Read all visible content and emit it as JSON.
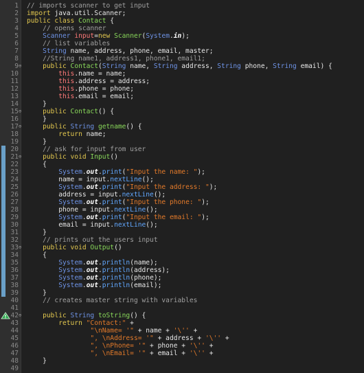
{
  "theme": {
    "background": "#202020",
    "keyword": "#e3c84f",
    "string": "#e37a2a",
    "comment": "#a0a0a0",
    "field": "#ff7a79",
    "type": "#6e93e6",
    "function": "#89d85a",
    "line_number": "#8a8a8a",
    "overview_marker": "#6aa0c8"
  },
  "editor": {
    "lines": [
      {
        "n": "1",
        "fold": "",
        "tokens": [
          {
            "t": "// imports scanner to get input",
            "c": "com"
          }
        ]
      },
      {
        "n": "2",
        "fold": "",
        "tokens": [
          {
            "t": "import ",
            "c": "kw"
          },
          {
            "t": "java.util.Scanner;",
            "c": "id"
          }
        ]
      },
      {
        "n": "3",
        "fold": "",
        "tokens": [
          {
            "t": "public class ",
            "c": "kw"
          },
          {
            "t": "Contact",
            "c": "fn"
          },
          {
            "t": " {",
            "c": "id"
          }
        ]
      },
      {
        "n": "4",
        "fold": "",
        "tokens": [
          {
            "t": "    // opens scanner",
            "c": "com"
          }
        ]
      },
      {
        "n": "5",
        "fold": "",
        "tokens": [
          {
            "t": "    ",
            "c": "id"
          },
          {
            "t": "Scanner",
            "c": "type"
          },
          {
            "t": " ",
            "c": "id"
          },
          {
            "t": "input",
            "c": "field"
          },
          {
            "t": "=",
            "c": "id"
          },
          {
            "t": "new ",
            "c": "kw"
          },
          {
            "t": "Scanner",
            "c": "fn"
          },
          {
            "t": "(",
            "c": "id"
          },
          {
            "t": "System",
            "c": "type"
          },
          {
            "t": ".",
            "c": "id"
          },
          {
            "t": "in",
            "c": "em"
          },
          {
            "t": ");",
            "c": "id"
          }
        ]
      },
      {
        "n": "6",
        "fold": "",
        "tokens": [
          {
            "t": "    // list variables",
            "c": "com"
          }
        ]
      },
      {
        "n": "7",
        "fold": "",
        "tokens": [
          {
            "t": "    ",
            "c": "id"
          },
          {
            "t": "String",
            "c": "type"
          },
          {
            "t": " name, address, phone, email, master;",
            "c": "id"
          }
        ]
      },
      {
        "n": "8",
        "fold": "",
        "tokens": [
          {
            "t": "    //String name1, address1, phone1, email1;",
            "c": "com"
          }
        ]
      },
      {
        "n": "9",
        "fold": "⊖",
        "tokens": [
          {
            "t": "    public ",
            "c": "kw"
          },
          {
            "t": "Contact",
            "c": "fn"
          },
          {
            "t": "(",
            "c": "id"
          },
          {
            "t": "String",
            "c": "type"
          },
          {
            "t": " name, ",
            "c": "id"
          },
          {
            "t": "String",
            "c": "type"
          },
          {
            "t": " address, ",
            "c": "id"
          },
          {
            "t": "String",
            "c": "type"
          },
          {
            "t": " phone, ",
            "c": "id"
          },
          {
            "t": "String",
            "c": "type"
          },
          {
            "t": " email) {",
            "c": "id"
          }
        ]
      },
      {
        "n": "10",
        "fold": "",
        "tokens": [
          {
            "t": "        ",
            "c": "id"
          },
          {
            "t": "this",
            "c": "field"
          },
          {
            "t": ".name = name;",
            "c": "id"
          }
        ]
      },
      {
        "n": "11",
        "fold": "",
        "tokens": [
          {
            "t": "        ",
            "c": "id"
          },
          {
            "t": "this",
            "c": "field"
          },
          {
            "t": ".address = address;",
            "c": "id"
          }
        ]
      },
      {
        "n": "12",
        "fold": "",
        "tokens": [
          {
            "t": "        ",
            "c": "id"
          },
          {
            "t": "this",
            "c": "field"
          },
          {
            "t": ".phone = phone;",
            "c": "id"
          }
        ]
      },
      {
        "n": "13",
        "fold": "",
        "tokens": [
          {
            "t": "        ",
            "c": "id"
          },
          {
            "t": "this",
            "c": "field"
          },
          {
            "t": ".email = email;",
            "c": "id"
          }
        ]
      },
      {
        "n": "14",
        "fold": "",
        "tokens": [
          {
            "t": "    }",
            "c": "id"
          }
        ]
      },
      {
        "n": "15",
        "fold": "⊖",
        "tokens": [
          {
            "t": "    public ",
            "c": "kw"
          },
          {
            "t": "Contact",
            "c": "fn"
          },
          {
            "t": "() {",
            "c": "id"
          }
        ]
      },
      {
        "n": "16",
        "fold": "",
        "tokens": [
          {
            "t": "    }",
            "c": "id"
          }
        ]
      },
      {
        "n": "17",
        "fold": "⊖",
        "tokens": [
          {
            "t": "    public ",
            "c": "kw"
          },
          {
            "t": "String",
            "c": "type"
          },
          {
            "t": " ",
            "c": "id"
          },
          {
            "t": "getname",
            "c": "fn"
          },
          {
            "t": "() {",
            "c": "id"
          }
        ]
      },
      {
        "n": "18",
        "fold": "",
        "tokens": [
          {
            "t": "        return ",
            "c": "kw"
          },
          {
            "t": "name;",
            "c": "id"
          }
        ]
      },
      {
        "n": "19",
        "fold": "",
        "tokens": [
          {
            "t": "    }",
            "c": "id"
          }
        ]
      },
      {
        "n": "20",
        "fold": "",
        "tokens": [
          {
            "t": "    // ask for input from user",
            "c": "com"
          }
        ]
      },
      {
        "n": "21",
        "fold": "⊖",
        "tokens": [
          {
            "t": "    public void ",
            "c": "kw"
          },
          {
            "t": "Input",
            "c": "fn"
          },
          {
            "t": "()",
            "c": "id"
          }
        ]
      },
      {
        "n": "22",
        "fold": "",
        "tokens": [
          {
            "t": "    {",
            "c": "id"
          }
        ]
      },
      {
        "n": "23",
        "fold": "",
        "tokens": [
          {
            "t": "        ",
            "c": "id"
          },
          {
            "t": "System",
            "c": "type"
          },
          {
            "t": ".",
            "c": "id"
          },
          {
            "t": "out",
            "c": "em"
          },
          {
            "t": ".",
            "c": "id"
          },
          {
            "t": "print",
            "c": "call"
          },
          {
            "t": "(",
            "c": "id"
          },
          {
            "t": "\"Input the name: \"",
            "c": "str"
          },
          {
            "t": ");",
            "c": "id"
          }
        ]
      },
      {
        "n": "24",
        "fold": "",
        "tokens": [
          {
            "t": "        name = input.",
            "c": "id"
          },
          {
            "t": "nextLine",
            "c": "call"
          },
          {
            "t": "();",
            "c": "id"
          }
        ]
      },
      {
        "n": "25",
        "fold": "",
        "tokens": [
          {
            "t": "        ",
            "c": "id"
          },
          {
            "t": "System",
            "c": "type"
          },
          {
            "t": ".",
            "c": "id"
          },
          {
            "t": "out",
            "c": "em"
          },
          {
            "t": ".",
            "c": "id"
          },
          {
            "t": "print",
            "c": "call"
          },
          {
            "t": "(",
            "c": "id"
          },
          {
            "t": "\"Input the address: \"",
            "c": "str"
          },
          {
            "t": ");",
            "c": "id"
          }
        ]
      },
      {
        "n": "26",
        "fold": "",
        "tokens": [
          {
            "t": "        address = input.",
            "c": "id"
          },
          {
            "t": "nextLine",
            "c": "call"
          },
          {
            "t": "();",
            "c": "id"
          }
        ]
      },
      {
        "n": "27",
        "fold": "",
        "tokens": [
          {
            "t": "        ",
            "c": "id"
          },
          {
            "t": "System",
            "c": "type"
          },
          {
            "t": ".",
            "c": "id"
          },
          {
            "t": "out",
            "c": "em"
          },
          {
            "t": ".",
            "c": "id"
          },
          {
            "t": "print",
            "c": "call"
          },
          {
            "t": "(",
            "c": "id"
          },
          {
            "t": "\"Input the phone: \"",
            "c": "str"
          },
          {
            "t": ");",
            "c": "id"
          }
        ]
      },
      {
        "n": "28",
        "fold": "",
        "tokens": [
          {
            "t": "        phone = input.",
            "c": "id"
          },
          {
            "t": "nextLine",
            "c": "call"
          },
          {
            "t": "();",
            "c": "id"
          }
        ]
      },
      {
        "n": "29",
        "fold": "",
        "tokens": [
          {
            "t": "        ",
            "c": "id"
          },
          {
            "t": "System",
            "c": "type"
          },
          {
            "t": ".",
            "c": "id"
          },
          {
            "t": "out",
            "c": "em"
          },
          {
            "t": ".",
            "c": "id"
          },
          {
            "t": "print",
            "c": "call"
          },
          {
            "t": "(",
            "c": "id"
          },
          {
            "t": "\"Input the email: \"",
            "c": "str"
          },
          {
            "t": ");",
            "c": "id"
          }
        ]
      },
      {
        "n": "30",
        "fold": "",
        "tokens": [
          {
            "t": "        email = input.",
            "c": "id"
          },
          {
            "t": "nextLine",
            "c": "call"
          },
          {
            "t": "();",
            "c": "id"
          }
        ]
      },
      {
        "n": "31",
        "fold": "",
        "tokens": [
          {
            "t": "    }",
            "c": "id"
          }
        ]
      },
      {
        "n": "32",
        "fold": "",
        "tokens": [
          {
            "t": "    // prints out the users input",
            "c": "com"
          }
        ]
      },
      {
        "n": "33",
        "fold": "⊖",
        "tokens": [
          {
            "t": "    public void ",
            "c": "kw"
          },
          {
            "t": "Output",
            "c": "fn"
          },
          {
            "t": "()",
            "c": "id"
          }
        ]
      },
      {
        "n": "34",
        "fold": "",
        "tokens": [
          {
            "t": "    {",
            "c": "id"
          }
        ]
      },
      {
        "n": "35",
        "fold": "",
        "tokens": [
          {
            "t": "        ",
            "c": "id"
          },
          {
            "t": "System",
            "c": "type"
          },
          {
            "t": ".",
            "c": "id"
          },
          {
            "t": "out",
            "c": "em"
          },
          {
            "t": ".",
            "c": "id"
          },
          {
            "t": "println",
            "c": "call"
          },
          {
            "t": "(name);",
            "c": "id"
          }
        ]
      },
      {
        "n": "36",
        "fold": "",
        "tokens": [
          {
            "t": "        ",
            "c": "id"
          },
          {
            "t": "System",
            "c": "type"
          },
          {
            "t": ".",
            "c": "id"
          },
          {
            "t": "out",
            "c": "em"
          },
          {
            "t": ".",
            "c": "id"
          },
          {
            "t": "println",
            "c": "call"
          },
          {
            "t": "(address);",
            "c": "id"
          }
        ]
      },
      {
        "n": "37",
        "fold": "",
        "tokens": [
          {
            "t": "        ",
            "c": "id"
          },
          {
            "t": "System",
            "c": "type"
          },
          {
            "t": ".",
            "c": "id"
          },
          {
            "t": "out",
            "c": "em"
          },
          {
            "t": ".",
            "c": "id"
          },
          {
            "t": "println",
            "c": "call"
          },
          {
            "t": "(phone);",
            "c": "id"
          }
        ]
      },
      {
        "n": "38",
        "fold": "",
        "tokens": [
          {
            "t": "        ",
            "c": "id"
          },
          {
            "t": "System",
            "c": "type"
          },
          {
            "t": ".",
            "c": "id"
          },
          {
            "t": "out",
            "c": "em"
          },
          {
            "t": ".",
            "c": "id"
          },
          {
            "t": "println",
            "c": "call"
          },
          {
            "t": "(email);",
            "c": "id"
          }
        ]
      },
      {
        "n": "39",
        "fold": "",
        "tokens": [
          {
            "t": "    }",
            "c": "id"
          }
        ]
      },
      {
        "n": "40",
        "fold": "",
        "tokens": [
          {
            "t": "    // creates master string with variables",
            "c": "com"
          }
        ]
      },
      {
        "n": "41",
        "fold": "",
        "tokens": []
      },
      {
        "n": "42",
        "fold": "⊖",
        "tokens": [
          {
            "t": "    public ",
            "c": "kw"
          },
          {
            "t": "String",
            "c": "type"
          },
          {
            "t": " ",
            "c": "id"
          },
          {
            "t": "toString",
            "c": "fn"
          },
          {
            "t": "() {",
            "c": "id"
          }
        ]
      },
      {
        "n": "43",
        "fold": "",
        "tokens": [
          {
            "t": "        return ",
            "c": "kw"
          },
          {
            "t": "\"Contact:\"",
            "c": "str"
          },
          {
            "t": " +",
            "c": "id"
          }
        ]
      },
      {
        "n": "44",
        "fold": "",
        "tokens": [
          {
            "t": "                \"\\nName= '\"",
            "c": "str"
          },
          {
            "t": " + name + ",
            "c": "id"
          },
          {
            "t": "'\\''",
            "c": "str"
          },
          {
            "t": " +",
            "c": "id"
          }
        ]
      },
      {
        "n": "45",
        "fold": "",
        "tokens": [
          {
            "t": "                \", \\nAddress= '\"",
            "c": "str"
          },
          {
            "t": " + address + ",
            "c": "id"
          },
          {
            "t": "'\\''",
            "c": "str"
          },
          {
            "t": " +",
            "c": "id"
          }
        ]
      },
      {
        "n": "46",
        "fold": "",
        "tokens": [
          {
            "t": "                \", \\nPhone= '\"",
            "c": "str"
          },
          {
            "t": " + phone + ",
            "c": "id"
          },
          {
            "t": "'\\''",
            "c": "str"
          },
          {
            "t": " +",
            "c": "id"
          }
        ]
      },
      {
        "n": "47",
        "fold": "",
        "tokens": [
          {
            "t": "                \", \\nEmail= '\"",
            "c": "str"
          },
          {
            "t": " + email + ",
            "c": "id"
          },
          {
            "t": "'\\''",
            "c": "str"
          },
          {
            "t": " +",
            "c": "id"
          }
        ]
      },
      {
        "n": "48",
        "fold": "",
        "tokens": [
          {
            "t": "    }",
            "c": "id"
          }
        ]
      },
      {
        "n": "49",
        "fold": "",
        "tokens": []
      }
    ],
    "marked_lines": [
      "20",
      "21",
      "22",
      "23",
      "24",
      "25",
      "26",
      "27",
      "28",
      "29",
      "30",
      "31",
      "32",
      "33",
      "34",
      "35",
      "36",
      "37",
      "38",
      "39"
    ],
    "warning_line": "42",
    "warning_icon": "warning-triangle-icon"
  }
}
